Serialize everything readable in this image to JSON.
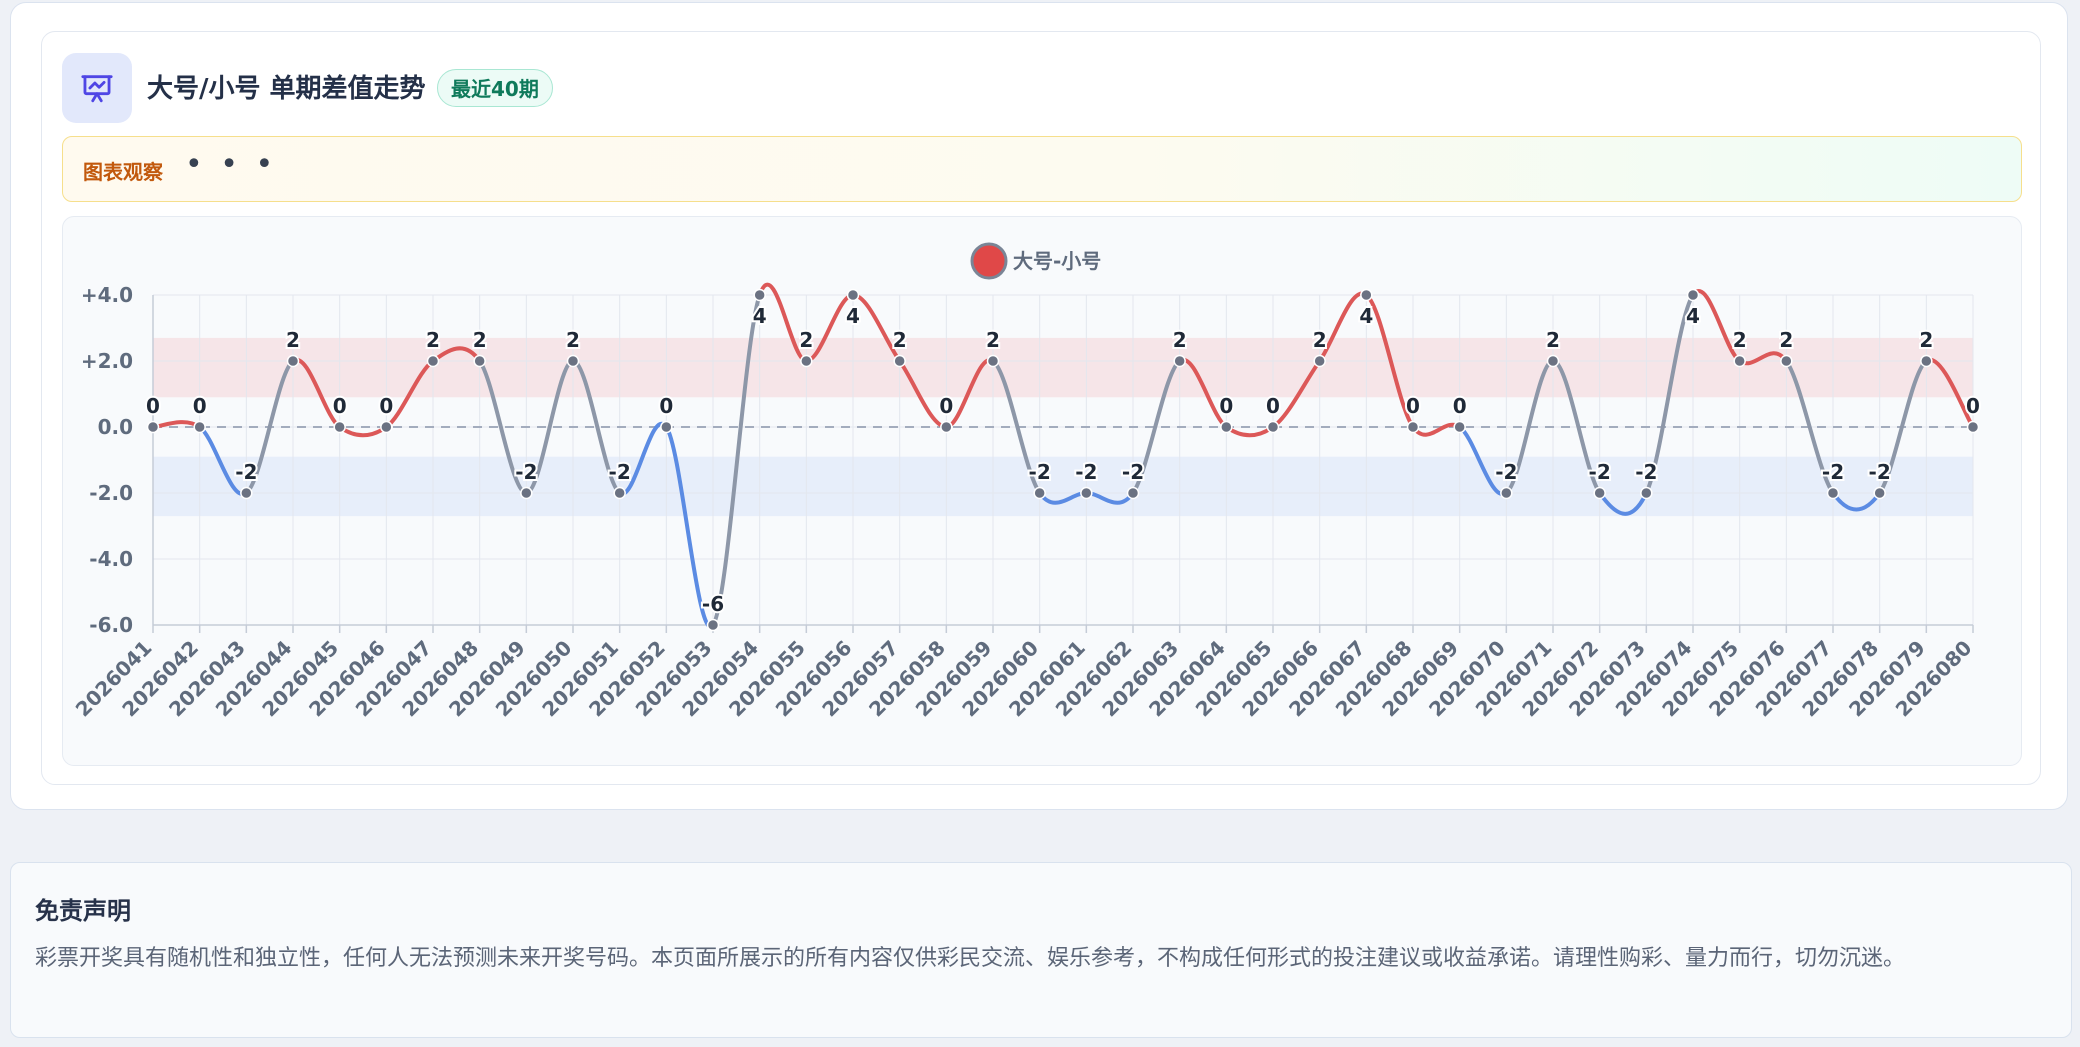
{
  "header": {
    "title": "大号/小号 单期差值走势",
    "badge": "最近40期",
    "icon": "presentation-chart-icon"
  },
  "observation": {
    "label": "图表观察",
    "dots": "• • •"
  },
  "chart_data": {
    "type": "line",
    "title": "",
    "xlabel": "",
    "ylabel": "",
    "ylim": [
      -6,
      4
    ],
    "yticks": [
      4,
      2,
      0,
      -2,
      -4,
      -6
    ],
    "ytick_labels": [
      "+4.0",
      "+2.0",
      "0.0",
      "-2.0",
      "-4.0",
      "-6.0"
    ],
    "legend_position": "top-center",
    "grid": true,
    "smooth": true,
    "bands": [
      {
        "from": 0.9,
        "to": 2.7,
        "color": "#f6dde2"
      },
      {
        "from": -2.7,
        "to": -0.9,
        "color": "#e2eafa"
      }
    ],
    "colors": {
      "up": "#dc5858",
      "down": "#5b8be3",
      "flat": "#8d97a8",
      "marker": "#6b7282",
      "baseline": "#a3acbd"
    },
    "categories": [
      "2026041",
      "2026042",
      "2026043",
      "2026044",
      "2026045",
      "2026046",
      "2026047",
      "2026048",
      "2026049",
      "2026050",
      "2026051",
      "2026052",
      "2026053",
      "2026054",
      "2026055",
      "2026056",
      "2026057",
      "2026058",
      "2026059",
      "2026060",
      "2026061",
      "2026062",
      "2026063",
      "2026064",
      "2026065",
      "2026066",
      "2026067",
      "2026068",
      "2026069",
      "2026070",
      "2026071",
      "2026072",
      "2026073",
      "2026074",
      "2026075",
      "2026076",
      "2026077",
      "2026078",
      "2026079",
      "2026080"
    ],
    "series": [
      {
        "name": "大号-小号",
        "color": "#e04848",
        "values": [
          0,
          0,
          -2,
          2,
          0,
          0,
          2,
          2,
          -2,
          2,
          -2,
          0,
          -6,
          4,
          2,
          4,
          2,
          0,
          2,
          -2,
          -2,
          -2,
          2,
          0,
          0,
          2,
          4,
          0,
          0,
          -2,
          2,
          -2,
          -2,
          4,
          2,
          2,
          -2,
          -2,
          2,
          0
        ]
      }
    ]
  },
  "disclaimer": {
    "title": "免责声明",
    "text": "彩票开奖具有随机性和独立性，任何人无法预测未来开奖号码。本页面所展示的所有内容仅供彩民交流、娱乐参考，不构成任何形式的投注建议或收益承诺。请理性购彩、量力而行，切勿沉迷。"
  }
}
